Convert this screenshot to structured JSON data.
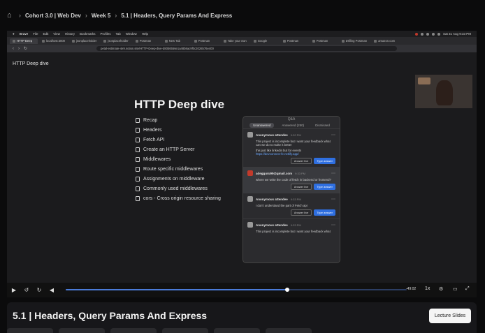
{
  "breadcrumb": {
    "items": [
      "Cohort 3.0 | Web Dev",
      "Week 5",
      "5.1 | Headers, Query Params And Express"
    ]
  },
  "mac_menubar": {
    "items": [
      "Brave",
      "File",
      "Edit",
      "View",
      "History",
      "Bookmarks",
      "Profiles",
      "Tab",
      "Window",
      "Help"
    ],
    "clock": "Sat 31 Aug 9:33 PM"
  },
  "browser": {
    "tabs": [
      {
        "label": "HTTP Deep",
        "active": true
      },
      {
        "label": "localhost:3000",
        "active": false
      },
      {
        "label": "jsonplaceholder",
        "active": false
      },
      {
        "label": "jsonplaceholder",
        "active": false
      },
      {
        "label": "Postman",
        "active": false
      },
      {
        "label": "New Tab",
        "active": false
      },
      {
        "label": "Postman",
        "active": false
      },
      {
        "label": "Take your own",
        "active": false
      },
      {
        "label": "Google",
        "active": false
      },
      {
        "label": "Postman",
        "active": false
      },
      {
        "label": "Postman",
        "active": false
      },
      {
        "label": "Drilling Postman",
        "active": false
      },
      {
        "label": "amazon.com",
        "active": false
      }
    ],
    "url": "petal-estimate-4e9.notion.site/HTTP-Deep-dive-d80b6556e1a48b8ac9f0c2026b76e400"
  },
  "slide": {
    "corner_title": "HTTP Deep dive",
    "title": "HTTP Deep dive",
    "topics": [
      "Recap",
      "Headers",
      "Fetch API",
      "Create an HTTP Server",
      "Middlewares",
      "Route specific middlewares",
      "Assignments on middleware",
      "Commonly used middlewares",
      "cors - Cross origin resource sharing"
    ]
  },
  "qa": {
    "title": "Q&A",
    "tabs": [
      "Unanswered",
      "Answered (250)",
      "Dismissed"
    ],
    "questions": [
      {
        "name": "Anonymous attendee",
        "time": "9:32 PM",
        "body": "This project is incomplete but I want your feedback what can we do to make it better",
        "body2": "this just like linkedin but for events",
        "link": "https://devconnect-fe.netlify.app/",
        "red_avatar": false,
        "highlight": false
      },
      {
        "name": "adegguru99@gmail.com",
        "time": "9:33 PM",
        "body": "where we write the code of fetch in backend or frontend?",
        "body2": "",
        "link": "",
        "red_avatar": true,
        "highlight": true
      },
      {
        "name": "Anonymous attendee",
        "time": "9:33 PM",
        "body": "I don't understand the part of Fetch api",
        "body2": "",
        "link": "",
        "red_avatar": false,
        "highlight": false
      },
      {
        "name": "Anonymous attendee",
        "time": "9:33 PM",
        "body": "This project is incomplete but I want your feedback what",
        "body2": "",
        "link": "",
        "red_avatar": false,
        "highlight": false
      }
    ],
    "answer_live_label": "Answer live",
    "type_answer_label": "Type answer"
  },
  "player": {
    "time_left": "-49:02",
    "progress": 0.65
  },
  "lecture": {
    "title": "5.1 | Headers, Query Params And Express",
    "slides_button": "Lecture Slides"
  }
}
